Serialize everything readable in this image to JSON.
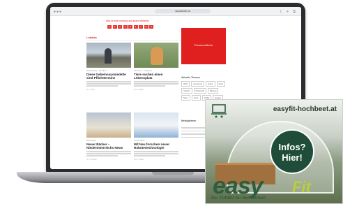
{
  "browser": {
    "url": "stadtseite.at",
    "window_controls": "●●●",
    "tools": "⇧ ＋ ⧉"
  },
  "page": {
    "notice": "Dies ist eine Vorschau auf unsere Webseite",
    "pagination": [
      "1",
      "2",
      "3",
      "4",
      "5",
      "6",
      "7",
      "8",
      "9"
    ],
    "section_title": "Lokales",
    "cards": [
      {
        "category": "Wieselburg · Friedhof",
        "title": "Diese Gebeinsaussiedelte sind Pflichttermine",
        "meta": "vor 1 Tag"
      },
      {
        "category": "Tierheim · Adoption",
        "title": "Tiere suchen einen Lebensplatz",
        "meta": "vor 2 Tagen"
      },
      {
        "category": "Wirtschaft",
        "title": "Neuer Bäcker – Niederösterreichs News",
        "meta": "vor 3 Tagen"
      },
      {
        "category": "Gesundheit",
        "title": "Mit Neu forschen neuer Robotertechnologie",
        "meta": "vor 3 Tagen"
      }
    ],
    "red_ad_label": "Premiumfläche",
    "sidebar_title": "Aktuelle Themen",
    "tags": [
      "Wahl",
      "Gemeinde",
      "Kultur",
      "Sport",
      "Verkehr",
      "Wirtschaft",
      "Bildung",
      "Natur",
      "Feste",
      "Politik",
      "Region"
    ],
    "sidebar_title2": "Meistgelesen"
  },
  "ad": {
    "url": "easyfit-hochbeet.at",
    "cta": "Infos? Hier!",
    "brand_easy": "easy",
    "brand_fit": "Fit",
    "tagline": "Der TURBO für den Garten!",
    "colors": {
      "brand_green": "#2e5e3e",
      "lime": "#b8cf3a",
      "badge": "#1f4d3a"
    }
  }
}
